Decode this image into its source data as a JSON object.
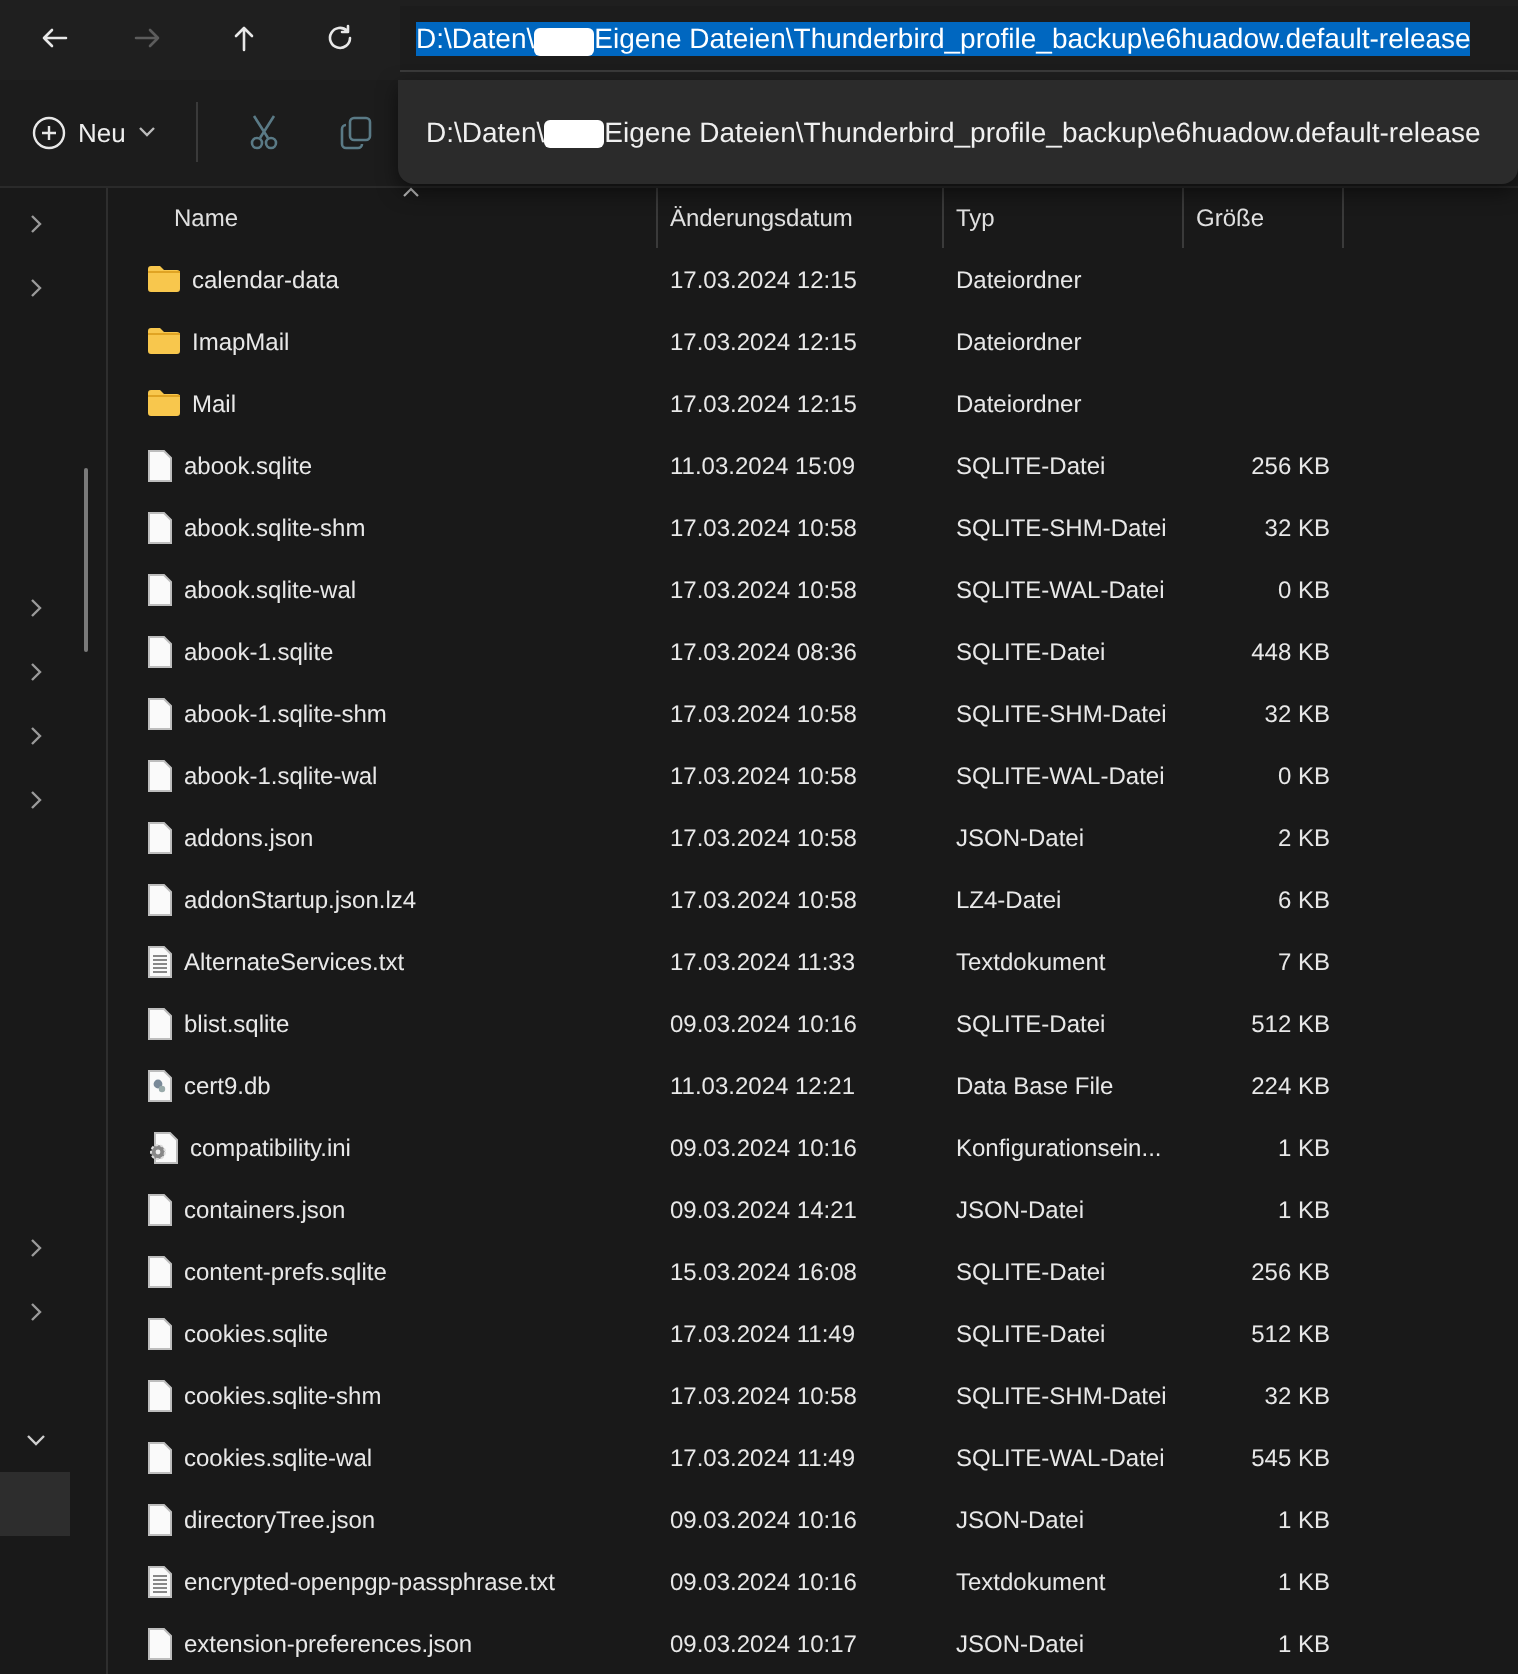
{
  "nav": [
    {
      "kind": "back",
      "disabled": false
    },
    {
      "kind": "forward",
      "disabled": true
    },
    {
      "kind": "up",
      "disabled": false
    },
    {
      "kind": "refresh",
      "disabled": false
    }
  ],
  "address": {
    "prefix": "D:\\Daten\\",
    "suffix": "Eigene Dateien\\Thunderbird_profile_backup\\e6huadow.default-release",
    "selected": true
  },
  "suggestion": {
    "prefix": "D:\\Daten\\",
    "suffix": "Eigene Dateien\\Thunderbird_profile_backup\\e6huadow.default-release"
  },
  "toolbar": {
    "new_label": "Neu",
    "actions": [
      {
        "kind": "cut",
        "disabled": true
      },
      {
        "kind": "copy",
        "disabled": true
      }
    ]
  },
  "sidebar": {
    "groups": [
      {
        "items": [
          {
            "expanded": false,
            "selected": false
          },
          {
            "expanded": false,
            "selected": false
          }
        ]
      },
      {
        "items": [
          {
            "expanded": false,
            "selected": false
          },
          {
            "expanded": false,
            "selected": false
          },
          {
            "expanded": false,
            "selected": false
          },
          {
            "expanded": false,
            "selected": false
          }
        ]
      },
      {
        "items": [
          {
            "expanded": false,
            "selected": false
          },
          {
            "expanded": false,
            "selected": false
          }
        ]
      },
      {
        "items": [
          {
            "expanded": true,
            "selected": false
          },
          {
            "selected": true
          }
        ]
      }
    ]
  },
  "table": {
    "columns": [
      {
        "label": "Name",
        "sorted": true
      },
      {
        "label": "Änderungsdatum",
        "sorted": false
      },
      {
        "label": "Typ",
        "sorted": false
      },
      {
        "label": "Größe",
        "sorted": false
      }
    ],
    "rows": [
      {
        "kind": "folder",
        "name": "calendar-data",
        "date": "17.03.2024 12:15",
        "type": "Dateiordner"
      },
      {
        "kind": "folder",
        "name": "ImapMail",
        "date": "17.03.2024 12:15",
        "type": "Dateiordner"
      },
      {
        "kind": "folder",
        "name": "Mail",
        "date": "17.03.2024 12:15",
        "type": "Dateiordner"
      },
      {
        "kind": "file",
        "name": "abook.sqlite",
        "date": "11.03.2024 15:09",
        "type": "SQLITE-Datei",
        "size": "256 KB"
      },
      {
        "kind": "file",
        "name": "abook.sqlite-shm",
        "date": "17.03.2024 10:58",
        "type": "SQLITE-SHM-Datei",
        "size": "32 KB"
      },
      {
        "kind": "file",
        "name": "abook.sqlite-wal",
        "date": "17.03.2024 10:58",
        "type": "SQLITE-WAL-Datei",
        "size": "0 KB"
      },
      {
        "kind": "file",
        "name": "abook-1.sqlite",
        "date": "17.03.2024 08:36",
        "type": "SQLITE-Datei",
        "size": "448 KB"
      },
      {
        "kind": "file",
        "name": "abook-1.sqlite-shm",
        "date": "17.03.2024 10:58",
        "type": "SQLITE-SHM-Datei",
        "size": "32 KB"
      },
      {
        "kind": "file",
        "name": "abook-1.sqlite-wal",
        "date": "17.03.2024 10:58",
        "type": "SQLITE-WAL-Datei",
        "size": "0 KB"
      },
      {
        "kind": "file",
        "name": "addons.json",
        "date": "17.03.2024 10:58",
        "type": "JSON-Datei",
        "size": "2 KB"
      },
      {
        "kind": "file",
        "name": "addonStartup.json.lz4",
        "date": "17.03.2024 10:58",
        "type": "LZ4-Datei",
        "size": "6 KB"
      },
      {
        "kind": "text",
        "name": "AlternateServices.txt",
        "date": "17.03.2024 11:33",
        "type": "Textdokument",
        "size": "7 KB"
      },
      {
        "kind": "file",
        "name": "blist.sqlite",
        "date": "09.03.2024 10:16",
        "type": "SQLITE-Datei",
        "size": "512 KB"
      },
      {
        "kind": "database",
        "name": "cert9.db",
        "date": "11.03.2024 12:21",
        "type": "Data Base File",
        "size": "224 KB"
      },
      {
        "kind": "config",
        "name": "compatibility.ini",
        "date": "09.03.2024 10:16",
        "type": "Konfigurationsein...",
        "size": "1 KB"
      },
      {
        "kind": "file",
        "name": "containers.json",
        "date": "09.03.2024 14:21",
        "type": "JSON-Datei",
        "size": "1 KB"
      },
      {
        "kind": "file",
        "name": "content-prefs.sqlite",
        "date": "15.03.2024 16:08",
        "type": "SQLITE-Datei",
        "size": "256 KB"
      },
      {
        "kind": "file",
        "name": "cookies.sqlite",
        "date": "17.03.2024 11:49",
        "type": "SQLITE-Datei",
        "size": "512 KB"
      },
      {
        "kind": "file",
        "name": "cookies.sqlite-shm",
        "date": "17.03.2024 10:58",
        "type": "SQLITE-SHM-Datei",
        "size": "32 KB"
      },
      {
        "kind": "file",
        "name": "cookies.sqlite-wal",
        "date": "17.03.2024 11:49",
        "type": "SQLITE-WAL-Datei",
        "size": "545 KB"
      },
      {
        "kind": "file",
        "name": "directoryTree.json",
        "date": "09.03.2024 10:16",
        "type": "JSON-Datei",
        "size": "1 KB"
      },
      {
        "kind": "text",
        "name": "encrypted-openpgp-passphrase.txt",
        "date": "09.03.2024 10:16",
        "type": "Textdokument",
        "size": "1 KB"
      },
      {
        "kind": "file",
        "name": "extension-preferences.json",
        "date": "09.03.2024 10:17",
        "type": "JSON-Datei",
        "size": "1 KB"
      }
    ]
  }
}
